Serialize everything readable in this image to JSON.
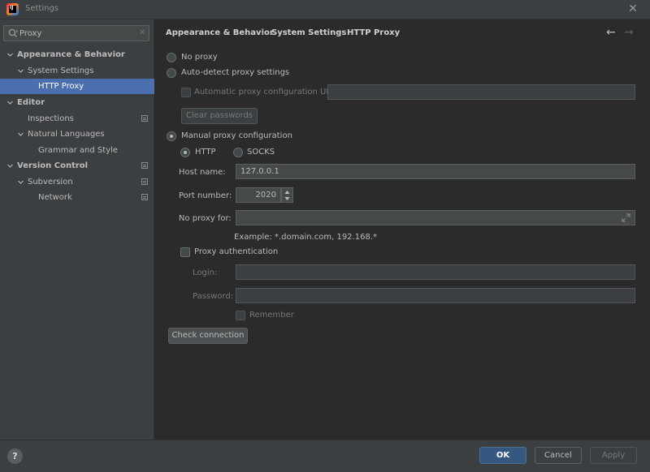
{
  "window": {
    "title": "Settings",
    "close_glyph": "✕",
    "app_icon_text": "IJ"
  },
  "sidebar": {
    "search": {
      "value": "Proxy",
      "clear_glyph": "✕"
    },
    "items": [
      {
        "label": "Appearance & Behavior",
        "bold": true
      },
      {
        "label": "System Settings"
      },
      {
        "label": "HTTP Proxy",
        "selected": true
      },
      {
        "label": "Editor",
        "bold": true
      },
      {
        "label": "Inspections"
      },
      {
        "label": "Natural Languages"
      },
      {
        "label": "Grammar and Style"
      },
      {
        "label": "Version Control",
        "bold": true
      },
      {
        "label": "Subversion"
      },
      {
        "label": "Network"
      }
    ]
  },
  "breadcrumb": {
    "items": [
      "Appearance & Behavior",
      "System Settings",
      "HTTP Proxy"
    ],
    "separator": "›",
    "back_glyph": "←",
    "forward_glyph": "→"
  },
  "proxy": {
    "no_proxy": "No proxy",
    "auto_detect": "Auto-detect proxy settings",
    "auto_config_url_label": "Automatic proxy configuration URL:",
    "auto_config_url_value": "",
    "clear_passwords": "Clear passwords",
    "manual": "Manual proxy configuration",
    "http": "HTTP",
    "socks": "SOCKS",
    "host_label": "Host name:",
    "host_value": "127.0.0.1",
    "port_label": "Port number:",
    "port_value": "2020",
    "no_proxy_for_label": "No proxy for:",
    "no_proxy_for_value": "",
    "example": "Example: *.domain.com, 192.168.*",
    "proxy_auth": "Proxy authentication",
    "login_label": "Login:",
    "login_value": "",
    "password_label": "Password:",
    "password_value": "",
    "remember": "Remember",
    "check_connection": "Check connection"
  },
  "footer": {
    "help": "?",
    "ok": "OK",
    "cancel": "Cancel",
    "apply": "Apply"
  },
  "colors": {
    "selection": "#4b6eaf",
    "primary_button": "#365880",
    "background": "#2b2b2b",
    "panel": "#3c3f41"
  }
}
